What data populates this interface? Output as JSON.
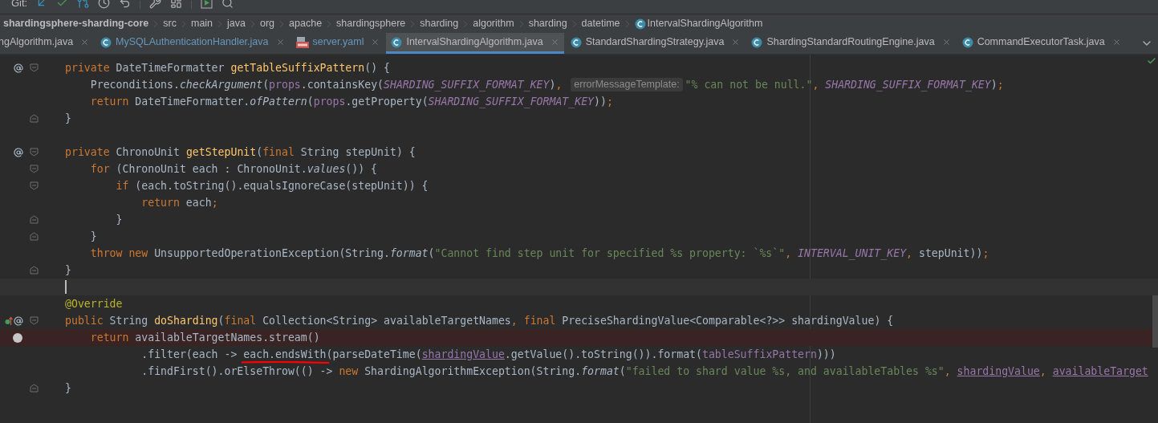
{
  "toolbar": {
    "label": "Git:"
  },
  "breadcrumbs": {
    "module": "shardingsphere-sharding-core",
    "items": [
      "src",
      "main",
      "java",
      "org",
      "apache",
      "shardingsphere",
      "sharding",
      "algorithm",
      "sharding",
      "datetime"
    ],
    "current": "IntervalShardingAlgorithm"
  },
  "tabs": [
    {
      "label": "ngAlgorithm.java",
      "kind": "plain",
      "color": "#bbbbbb",
      "selected": false
    },
    {
      "label": "MySQLAuthenticationHandler.java",
      "kind": "class",
      "color": "#6897bb",
      "selected": false
    },
    {
      "label": "server.yaml",
      "kind": "yaml",
      "color": "#6897bb",
      "selected": false
    },
    {
      "label": "IntervalShardingAlgorithm.java",
      "kind": "class",
      "color": "#bbbbbb",
      "selected": true
    },
    {
      "label": "StandardShardingStrategy.java",
      "kind": "class",
      "color": "#bbbbbb",
      "selected": false
    },
    {
      "label": "ShardingStandardRoutingEngine.java",
      "kind": "class",
      "color": "#bbbbbb",
      "selected": false
    },
    {
      "label": "CommandExecutorTask.java",
      "kind": "class",
      "color": "#bbbbbb",
      "selected": false
    }
  ],
  "lines": [
    {
      "kind": "plain",
      "gutter": {
        "kind": "override"
      },
      "fold": {
        "kind": "start"
      },
      "tokens": [
        {
          "kind": "kw",
          "text": "private "
        },
        {
          "kind": "plain",
          "text": "DateTimeFormatter "
        },
        {
          "kind": "decl",
          "text": "getTableSuffixPattern"
        },
        {
          "kind": "plain",
          "text": "() {"
        }
      ]
    },
    {
      "kind": "plain",
      "tokens": [
        {
          "kind": "plain",
          "text": "    Preconditions."
        },
        {
          "kind": "static",
          "text": "checkArgument"
        },
        {
          "kind": "plain",
          "text": "("
        },
        {
          "kind": "field",
          "text": "props"
        },
        {
          "kind": "plain",
          "text": ".containsKey("
        },
        {
          "kind": "const",
          "text": "SHARDING_SUFFIX_FORMAT_KEY"
        },
        {
          "kind": "plain",
          "text": ")"
        },
        {
          "kind": "kw",
          "text": ", "
        },
        {
          "kind": "hint",
          "text": "errorMessageTemplate:"
        },
        {
          "kind": "str",
          "text": "\"% can not be null.\""
        },
        {
          "kind": "kw",
          "text": ", "
        },
        {
          "kind": "const",
          "text": "SHARDING_SUFFIX_FORMAT_KEY"
        },
        {
          "kind": "plain",
          "text": ")"
        },
        {
          "kind": "kw",
          "text": ";"
        }
      ]
    },
    {
      "kind": "plain",
      "tokens": [
        {
          "kind": "kw",
          "text": "    return "
        },
        {
          "kind": "plain",
          "text": "DateTimeFormatter."
        },
        {
          "kind": "static",
          "text": "ofPattern"
        },
        {
          "kind": "plain",
          "text": "("
        },
        {
          "kind": "field",
          "text": "props"
        },
        {
          "kind": "plain",
          "text": ".getProperty("
        },
        {
          "kind": "const",
          "text": "SHARDING_SUFFIX_FORMAT_KEY"
        },
        {
          "kind": "plain",
          "text": "))"
        },
        {
          "kind": "kw",
          "text": ";"
        }
      ]
    },
    {
      "kind": "plain",
      "fold": {
        "kind": "end"
      },
      "tokens": [
        {
          "kind": "plain",
          "text": "}"
        }
      ]
    },
    {
      "kind": "plain"
    },
    {
      "kind": "plain",
      "gutter": {
        "kind": "override"
      },
      "fold": {
        "kind": "start"
      },
      "tokens": [
        {
          "kind": "kw",
          "text": "private "
        },
        {
          "kind": "plain",
          "text": "ChronoUnit "
        },
        {
          "kind": "decl",
          "text": "getStepUnit"
        },
        {
          "kind": "plain",
          "text": "("
        },
        {
          "kind": "kw",
          "text": "final "
        },
        {
          "kind": "plain",
          "text": "String stepUnit) {"
        }
      ]
    },
    {
      "kind": "plain",
      "fold": {
        "kind": "start"
      },
      "tokens": [
        {
          "kind": "kw",
          "text": "    for "
        },
        {
          "kind": "plain",
          "text": "(ChronoUnit each : ChronoUnit."
        },
        {
          "kind": "static",
          "text": "values"
        },
        {
          "kind": "plain",
          "text": "()) {"
        }
      ]
    },
    {
      "kind": "plain",
      "fold": {
        "kind": "start"
      },
      "tokens": [
        {
          "kind": "kw",
          "text": "        if "
        },
        {
          "kind": "plain",
          "text": "(each.toString().equalsIgnoreCase(stepUnit)) {"
        }
      ]
    },
    {
      "kind": "plain",
      "tokens": [
        {
          "kind": "kw",
          "text": "            return "
        },
        {
          "kind": "plain",
          "text": "each"
        },
        {
          "kind": "kw",
          "text": ";"
        }
      ]
    },
    {
      "kind": "plain",
      "fold": {
        "kind": "end"
      },
      "tokens": [
        {
          "kind": "plain",
          "text": "        }"
        }
      ]
    },
    {
      "kind": "plain",
      "fold": {
        "kind": "end"
      },
      "tokens": [
        {
          "kind": "plain",
          "text": "    }"
        }
      ]
    },
    {
      "kind": "plain",
      "tokens": [
        {
          "kind": "kw",
          "text": "    throw new "
        },
        {
          "kind": "plain",
          "text": "UnsupportedOperationException(String."
        },
        {
          "kind": "static",
          "text": "format"
        },
        {
          "kind": "plain",
          "text": "("
        },
        {
          "kind": "str",
          "text": "\"Cannot find step unit for specified %s property: `%s`\""
        },
        {
          "kind": "kw",
          "text": ", "
        },
        {
          "kind": "const",
          "text": "INTERVAL_UNIT_KEY"
        },
        {
          "kind": "kw",
          "text": ", "
        },
        {
          "kind": "plain",
          "text": "stepUnit))"
        },
        {
          "kind": "kw",
          "text": ";"
        }
      ]
    },
    {
      "kind": "plain",
      "fold": {
        "kind": "end"
      },
      "tokens": [
        {
          "kind": "plain",
          "text": "}"
        }
      ]
    },
    {
      "kind": "caret"
    },
    {
      "kind": "plain",
      "tokens": [
        {
          "kind": "ann",
          "text": "@Override"
        }
      ]
    },
    {
      "kind": "plain",
      "gutter": {
        "kind": "implements"
      },
      "fold": {
        "kind": "start"
      },
      "tokens": [
        {
          "kind": "kw",
          "text": "public "
        },
        {
          "kind": "plain",
          "text": "String "
        },
        {
          "kind": "decl",
          "text": "doSharding"
        },
        {
          "kind": "plain",
          "text": "("
        },
        {
          "kind": "kw",
          "text": "final "
        },
        {
          "kind": "plain",
          "text": "Collection<String> availableTargetNames"
        },
        {
          "kind": "kw",
          "text": ", final "
        },
        {
          "kind": "plain",
          "text": "PreciseShardingValue<Comparable<?>> shardingValue) {"
        }
      ]
    },
    {
      "kind": "breakpoint",
      "gutter": {
        "kind": "breakpoint"
      },
      "tokens": [
        {
          "kind": "kw",
          "text": "    return "
        },
        {
          "kind": "plain",
          "text": "availableTargetNames.stream()"
        }
      ]
    },
    {
      "kind": "plain",
      "tokens": [
        {
          "kind": "plain",
          "text": "            .filter(each -> "
        },
        {
          "kind": "scribbled",
          "text": "each.endsWith"
        },
        {
          "kind": "plain",
          "text": "(parseDateTime("
        },
        {
          "kind": "ufield",
          "text": "shardingValue"
        },
        {
          "kind": "plain",
          "text": ".getValue().toString()).format("
        },
        {
          "kind": "field",
          "text": "tableSuffixPattern"
        },
        {
          "kind": "plain",
          "text": ")))"
        }
      ]
    },
    {
      "kind": "plain",
      "tokens": [
        {
          "kind": "plain",
          "text": "            .findFirst().orElseThrow(() -> "
        },
        {
          "kind": "kw",
          "text": "new "
        },
        {
          "kind": "plain",
          "text": "ShardingAlgorithmException(String."
        },
        {
          "kind": "static",
          "text": "format"
        },
        {
          "kind": "plain",
          "text": "("
        },
        {
          "kind": "str",
          "text": "\"failed to shard value %s, and availableTables %s\""
        },
        {
          "kind": "kw",
          "text": ", "
        },
        {
          "kind": "ufield",
          "text": "shardingValue"
        },
        {
          "kind": "kw",
          "text": ", "
        },
        {
          "kind": "ufield",
          "text": "availableTarget"
        }
      ]
    },
    {
      "kind": "plain",
      "fold": {
        "kind": "end"
      },
      "tokens": [
        {
          "kind": "plain",
          "text": "}"
        }
      ]
    }
  ]
}
